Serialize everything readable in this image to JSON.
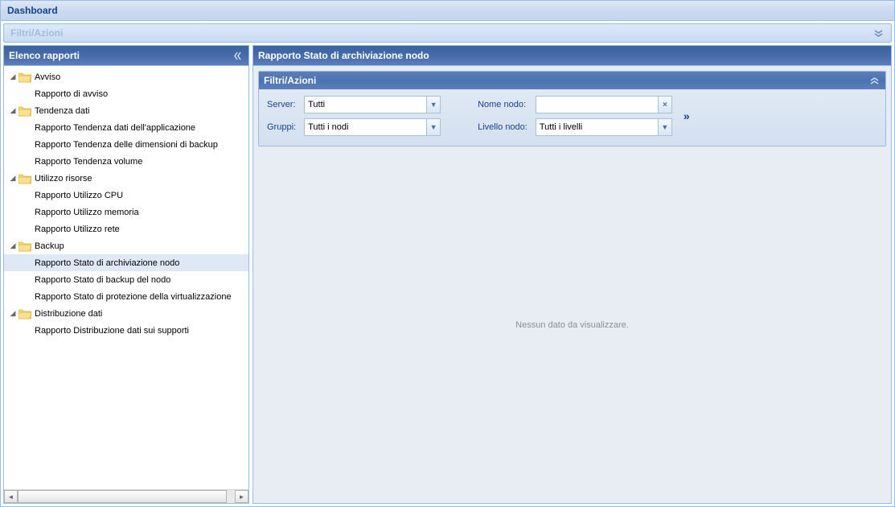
{
  "dashboard": {
    "title": "Dashboard"
  },
  "top_filters": {
    "title": "Filtri/Azioni",
    "expand_icon": "chevron-double-down"
  },
  "left_panel": {
    "title": "Elenco rapporti",
    "collapse_icon": "chevron-double-left"
  },
  "tree": [
    {
      "label": "Avviso",
      "expanded": true,
      "children": [
        {
          "label": "Rapporto di avviso"
        }
      ]
    },
    {
      "label": "Tendenza dati",
      "expanded": true,
      "children": [
        {
          "label": "Rapporto Tendenza dati dell'applicazione"
        },
        {
          "label": "Rapporto Tendenza delle dimensioni di backup"
        },
        {
          "label": "Rapporto Tendenza volume"
        }
      ]
    },
    {
      "label": "Utilizzo risorse",
      "expanded": true,
      "children": [
        {
          "label": "Rapporto Utilizzo CPU"
        },
        {
          "label": "Rapporto Utilizzo memoria"
        },
        {
          "label": "Rapporto Utilizzo rete"
        }
      ]
    },
    {
      "label": "Backup",
      "expanded": true,
      "children": [
        {
          "label": "Rapporto Stato di archiviazione nodo",
          "selected": true
        },
        {
          "label": "Rapporto Stato di backup del nodo"
        },
        {
          "label": "Rapporto Stato di protezione della virtualizzazione"
        }
      ]
    },
    {
      "label": "Distribuzione dati",
      "expanded": true,
      "children": [
        {
          "label": "Rapporto Distribuzione dati sui supporti"
        }
      ]
    }
  ],
  "right_panel": {
    "title": "Rapporto Stato di archiviazione nodo"
  },
  "sub_filters": {
    "title": "Filtri/Azioni",
    "server_label": "Server:",
    "server_value": "Tutti",
    "gruppi_label": "Gruppi:",
    "gruppi_value": "Tutti i nodi",
    "nome_nodo_label": "Nome nodo:",
    "nome_nodo_value": "",
    "livello_nodo_label": "Livello nodo:",
    "livello_nodo_value": "Tutti i livelli",
    "action_glyph": "»"
  },
  "report": {
    "empty_text": "Nessun dato da visualizzare."
  }
}
